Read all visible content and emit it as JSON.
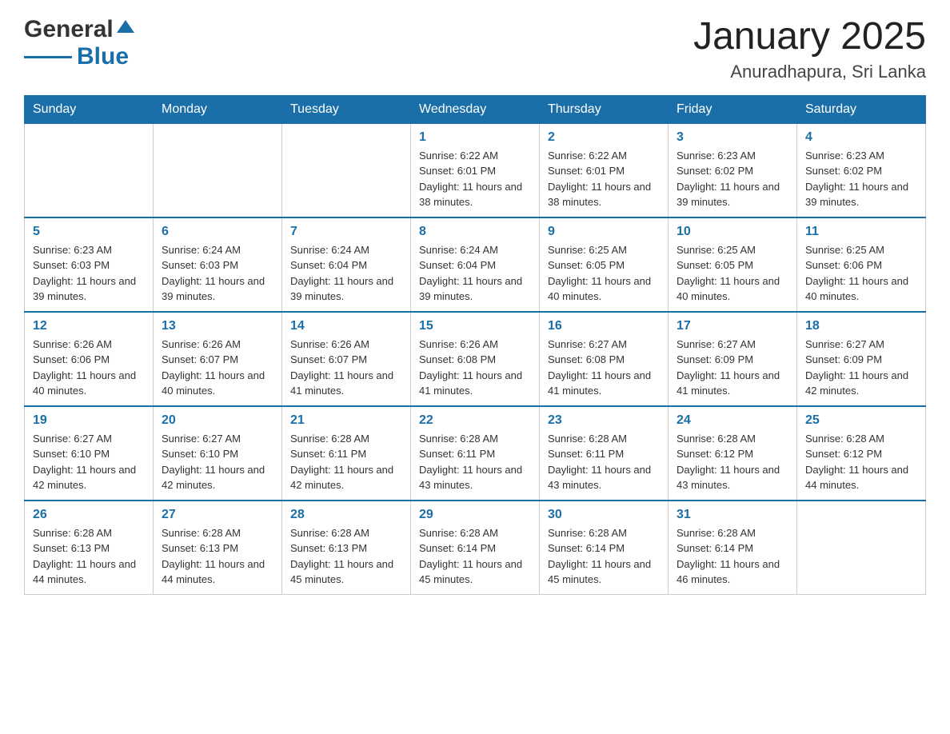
{
  "header": {
    "logo_general": "General",
    "logo_blue": "Blue",
    "title": "January 2025",
    "subtitle": "Anuradhapura, Sri Lanka"
  },
  "days_of_week": [
    "Sunday",
    "Monday",
    "Tuesday",
    "Wednesday",
    "Thursday",
    "Friday",
    "Saturday"
  ],
  "weeks": [
    [
      {
        "day": "",
        "info": ""
      },
      {
        "day": "",
        "info": ""
      },
      {
        "day": "",
        "info": ""
      },
      {
        "day": "1",
        "info": "Sunrise: 6:22 AM\nSunset: 6:01 PM\nDaylight: 11 hours and 38 minutes."
      },
      {
        "day": "2",
        "info": "Sunrise: 6:22 AM\nSunset: 6:01 PM\nDaylight: 11 hours and 38 minutes."
      },
      {
        "day": "3",
        "info": "Sunrise: 6:23 AM\nSunset: 6:02 PM\nDaylight: 11 hours and 39 minutes."
      },
      {
        "day": "4",
        "info": "Sunrise: 6:23 AM\nSunset: 6:02 PM\nDaylight: 11 hours and 39 minutes."
      }
    ],
    [
      {
        "day": "5",
        "info": "Sunrise: 6:23 AM\nSunset: 6:03 PM\nDaylight: 11 hours and 39 minutes."
      },
      {
        "day": "6",
        "info": "Sunrise: 6:24 AM\nSunset: 6:03 PM\nDaylight: 11 hours and 39 minutes."
      },
      {
        "day": "7",
        "info": "Sunrise: 6:24 AM\nSunset: 6:04 PM\nDaylight: 11 hours and 39 minutes."
      },
      {
        "day": "8",
        "info": "Sunrise: 6:24 AM\nSunset: 6:04 PM\nDaylight: 11 hours and 39 minutes."
      },
      {
        "day": "9",
        "info": "Sunrise: 6:25 AM\nSunset: 6:05 PM\nDaylight: 11 hours and 40 minutes."
      },
      {
        "day": "10",
        "info": "Sunrise: 6:25 AM\nSunset: 6:05 PM\nDaylight: 11 hours and 40 minutes."
      },
      {
        "day": "11",
        "info": "Sunrise: 6:25 AM\nSunset: 6:06 PM\nDaylight: 11 hours and 40 minutes."
      }
    ],
    [
      {
        "day": "12",
        "info": "Sunrise: 6:26 AM\nSunset: 6:06 PM\nDaylight: 11 hours and 40 minutes."
      },
      {
        "day": "13",
        "info": "Sunrise: 6:26 AM\nSunset: 6:07 PM\nDaylight: 11 hours and 40 minutes."
      },
      {
        "day": "14",
        "info": "Sunrise: 6:26 AM\nSunset: 6:07 PM\nDaylight: 11 hours and 41 minutes."
      },
      {
        "day": "15",
        "info": "Sunrise: 6:26 AM\nSunset: 6:08 PM\nDaylight: 11 hours and 41 minutes."
      },
      {
        "day": "16",
        "info": "Sunrise: 6:27 AM\nSunset: 6:08 PM\nDaylight: 11 hours and 41 minutes."
      },
      {
        "day": "17",
        "info": "Sunrise: 6:27 AM\nSunset: 6:09 PM\nDaylight: 11 hours and 41 minutes."
      },
      {
        "day": "18",
        "info": "Sunrise: 6:27 AM\nSunset: 6:09 PM\nDaylight: 11 hours and 42 minutes."
      }
    ],
    [
      {
        "day": "19",
        "info": "Sunrise: 6:27 AM\nSunset: 6:10 PM\nDaylight: 11 hours and 42 minutes."
      },
      {
        "day": "20",
        "info": "Sunrise: 6:27 AM\nSunset: 6:10 PM\nDaylight: 11 hours and 42 minutes."
      },
      {
        "day": "21",
        "info": "Sunrise: 6:28 AM\nSunset: 6:11 PM\nDaylight: 11 hours and 42 minutes."
      },
      {
        "day": "22",
        "info": "Sunrise: 6:28 AM\nSunset: 6:11 PM\nDaylight: 11 hours and 43 minutes."
      },
      {
        "day": "23",
        "info": "Sunrise: 6:28 AM\nSunset: 6:11 PM\nDaylight: 11 hours and 43 minutes."
      },
      {
        "day": "24",
        "info": "Sunrise: 6:28 AM\nSunset: 6:12 PM\nDaylight: 11 hours and 43 minutes."
      },
      {
        "day": "25",
        "info": "Sunrise: 6:28 AM\nSunset: 6:12 PM\nDaylight: 11 hours and 44 minutes."
      }
    ],
    [
      {
        "day": "26",
        "info": "Sunrise: 6:28 AM\nSunset: 6:13 PM\nDaylight: 11 hours and 44 minutes."
      },
      {
        "day": "27",
        "info": "Sunrise: 6:28 AM\nSunset: 6:13 PM\nDaylight: 11 hours and 44 minutes."
      },
      {
        "day": "28",
        "info": "Sunrise: 6:28 AM\nSunset: 6:13 PM\nDaylight: 11 hours and 45 minutes."
      },
      {
        "day": "29",
        "info": "Sunrise: 6:28 AM\nSunset: 6:14 PM\nDaylight: 11 hours and 45 minutes."
      },
      {
        "day": "30",
        "info": "Sunrise: 6:28 AM\nSunset: 6:14 PM\nDaylight: 11 hours and 45 minutes."
      },
      {
        "day": "31",
        "info": "Sunrise: 6:28 AM\nSunset: 6:14 PM\nDaylight: 11 hours and 46 minutes."
      },
      {
        "day": "",
        "info": ""
      }
    ]
  ]
}
